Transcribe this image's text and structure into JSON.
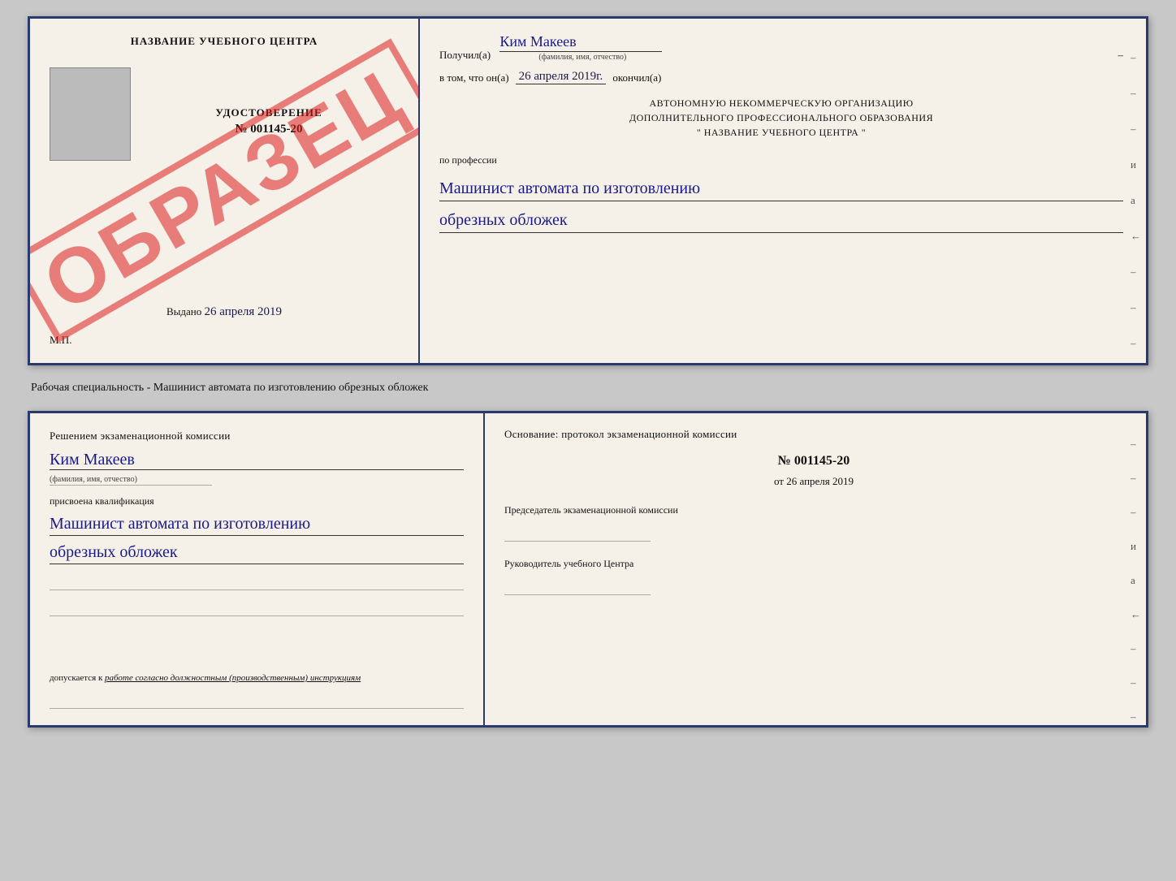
{
  "top_doc": {
    "left": {
      "title": "НАЗВАНИЕ УЧЕБНОГО ЦЕНТРА",
      "cert_label": "УДОСТОВЕРЕНИЕ",
      "cert_number": "№ 001145-20",
      "issued_label": "Выдано",
      "issued_date": "26 апреля 2019",
      "mp": "М.П.",
      "watermark": "ОБРАЗЕЦ"
    },
    "right": {
      "recipient_prefix": "Получил(а)",
      "recipient_name": "Ким Макеев",
      "recipient_sub": "(фамилия, имя, отчество)",
      "dash": "–",
      "date_prefix": "в том, что он(а)",
      "date_value": "26 апреля 2019г.",
      "date_suffix": "окончил(а)",
      "org_line1": "АВТОНОМНУЮ НЕКОММЕРЧЕСКУЮ ОРГАНИЗАЦИЮ",
      "org_line2": "ДОПОЛНИТЕЛЬНОГО ПРОФЕССИОНАЛЬНОГО ОБРАЗОВАНИЯ",
      "org_line3": "\"  НАЗВАНИЕ УЧЕБНОГО ЦЕНТРА  \"",
      "profession_label": "по профессии",
      "profession_line1": "Машинист автомата по изготовлению",
      "profession_line2": "обрезных обложек",
      "side_dashes": [
        "–",
        "–",
        "–",
        "и",
        "а",
        "←",
        "–",
        "–",
        "–"
      ]
    }
  },
  "middle": {
    "caption": "Рабочая специальность - Машинист автомата по изготовлению обрезных обложек"
  },
  "bottom_doc": {
    "left": {
      "decision": "Решением экзаменационной комиссии",
      "name": "Ким Макеев",
      "name_sub": "(фамилия, имя, отчество)",
      "assigned": "присвоена квалификация",
      "qual_line1": "Машинист автомата по изготовлению",
      "qual_line2": "обрезных обложек",
      "допускается_prefix": "допускается к",
      "допускается_val": "работе согласно должностным (производственным) инструкциям"
    },
    "right": {
      "basis": "Основание: протокол экзаменационной комиссии",
      "number": "№ 001145-20",
      "date_prefix": "от",
      "date_value": "26 апреля 2019",
      "chairman_label": "Председатель экзаменационной комиссии",
      "director_label": "Руководитель учебного Центра",
      "side_dashes": [
        "–",
        "–",
        "–",
        "и",
        "а",
        "←",
        "–",
        "–",
        "–"
      ]
    }
  }
}
